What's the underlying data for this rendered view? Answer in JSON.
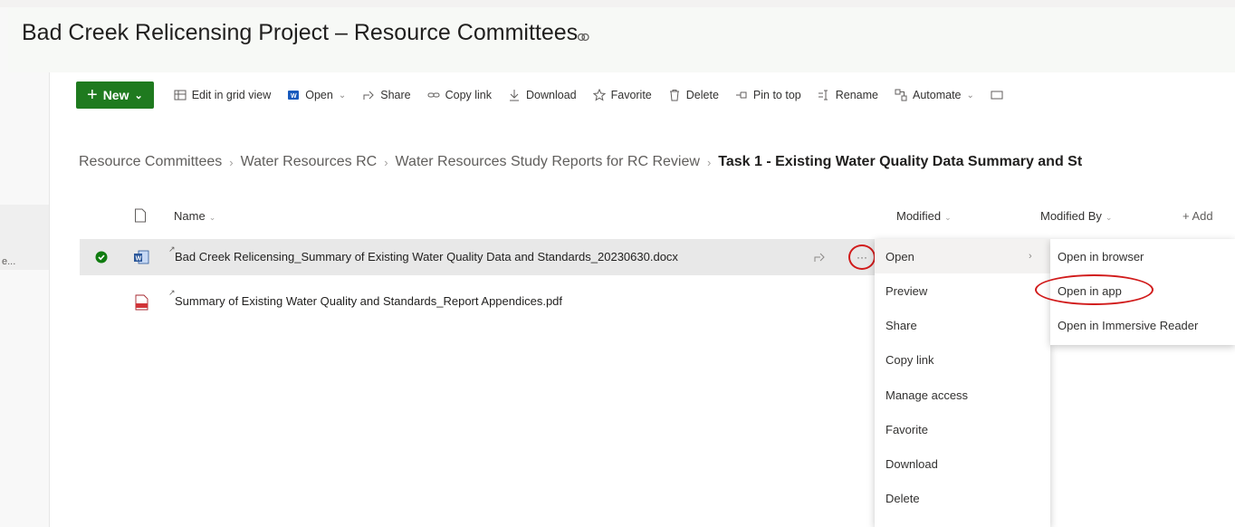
{
  "site": {
    "title": "Bad Creek Relicensing Project – Resource Committees"
  },
  "rail": {
    "ellipsis": "e..."
  },
  "commandbar": {
    "new_label": "New",
    "items": [
      {
        "label": "Edit in grid view",
        "icon": "grid-icon",
        "has_dropdown": false
      },
      {
        "label": "Open",
        "icon": "word-app-icon",
        "has_dropdown": true
      },
      {
        "label": "Share",
        "icon": "share-icon",
        "has_dropdown": false
      },
      {
        "label": "Copy link",
        "icon": "link-icon",
        "has_dropdown": false
      },
      {
        "label": "Download",
        "icon": "download-icon",
        "has_dropdown": false
      },
      {
        "label": "Favorite",
        "icon": "star-icon",
        "has_dropdown": false
      },
      {
        "label": "Delete",
        "icon": "trash-icon",
        "has_dropdown": false
      },
      {
        "label": "Pin to top",
        "icon": "pin-icon",
        "has_dropdown": false
      },
      {
        "label": "Rename",
        "icon": "rename-icon",
        "has_dropdown": false
      },
      {
        "label": "Automate",
        "icon": "automate-icon",
        "has_dropdown": true
      }
    ]
  },
  "breadcrumb": {
    "items": [
      "Resource Committees",
      "Water Resources RC",
      "Water Resources Study Reports for RC Review"
    ],
    "current": "Task 1 - Existing Water Quality Data Summary and St"
  },
  "list": {
    "columns": {
      "name": "Name",
      "modified": "Modified",
      "modified_by": "Modified By",
      "add_column": "+ Add"
    },
    "rows": [
      {
        "name": "Bad Creek Relicensing_Summary of Existing Water Quality Data and Standards_20230630.docx",
        "icon": "word-file-icon",
        "selected": true
      },
      {
        "name": "Summary of Existing Water Quality and Standards_Report Appendices.pdf",
        "icon": "pdf-file-icon",
        "selected": false
      }
    ]
  },
  "context_menu": {
    "items": [
      "Open",
      "Preview",
      "Share",
      "Copy link",
      "Manage access",
      "Favorite",
      "Download",
      "Delete"
    ]
  },
  "open_submenu": {
    "items": [
      "Open in browser",
      "Open in app",
      "Open in Immersive Reader"
    ]
  },
  "colors": {
    "new_button": "#1f7a1f",
    "highlight_circle": "#d11b1b",
    "selected_row": "#e8e8e8"
  }
}
